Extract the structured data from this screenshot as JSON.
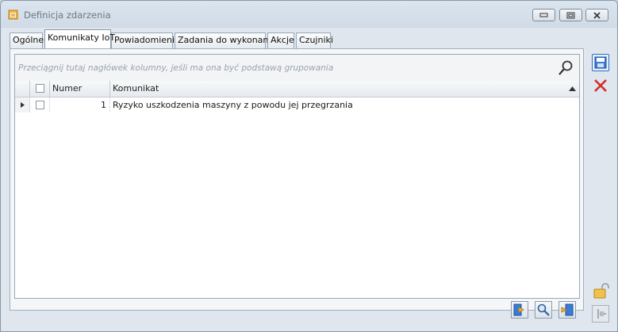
{
  "window": {
    "title": "Definicja zdarzenia"
  },
  "tabs": [
    {
      "label": "Ogólne"
    },
    {
      "label": "Komunikaty IoT"
    },
    {
      "label": "Powiadomienia"
    },
    {
      "label": "Zadania do wykonania"
    },
    {
      "label": "Akcje"
    },
    {
      "label": "Czujniki"
    }
  ],
  "active_tab": "Komunikaty IoT",
  "grid": {
    "group_hint": "Przeciągnij tutaj nagłówek kolumny, jeśli ma ona być podstawą grupowania",
    "columns": [
      {
        "label": "Numer"
      },
      {
        "label": "Komunikat"
      }
    ],
    "rows": [
      {
        "numer": "1",
        "komunikat": "Ryzyko uszkodzenia maszyny z powodu jej przegrzania"
      }
    ]
  },
  "colors": {
    "accent_blue": "#2a6fc9",
    "delete_red": "#d32f2f",
    "window_bg": "#dfe6ee"
  },
  "icons": [
    "minimize-icon",
    "restore-icon",
    "close-icon",
    "search-icon",
    "save-icon",
    "cancel-icon",
    "lock-icon",
    "pin-icon",
    "add-icon",
    "preview-icon",
    "remove-icon"
  ]
}
